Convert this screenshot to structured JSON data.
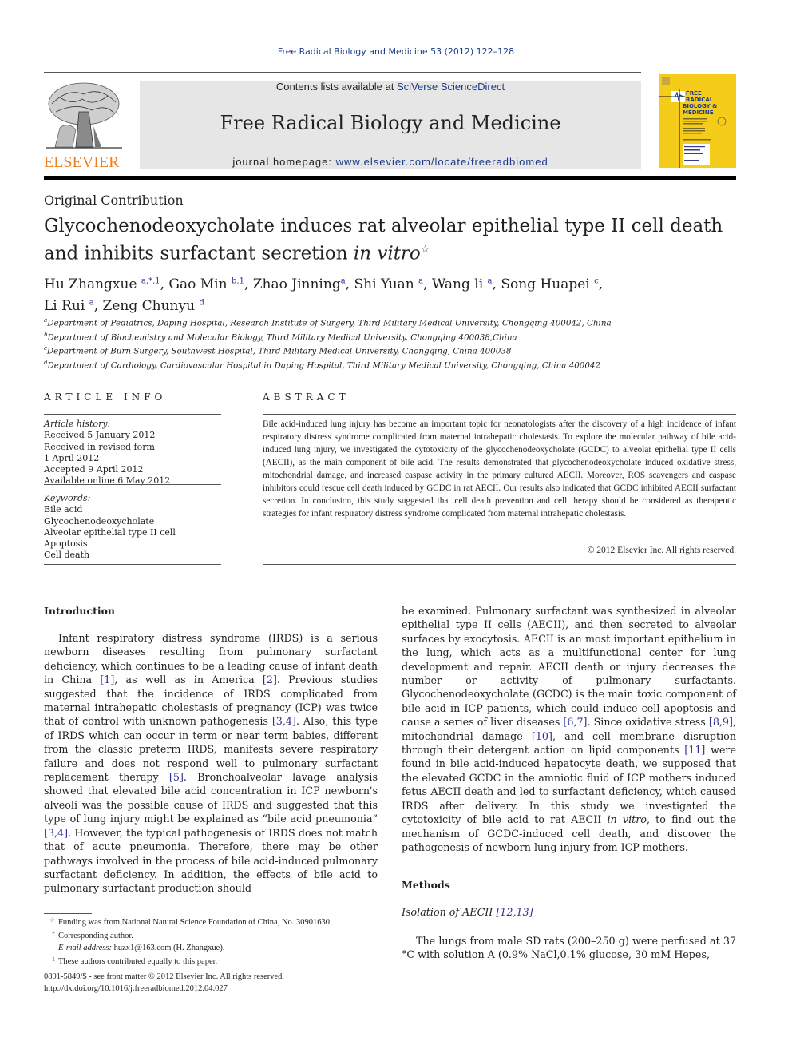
{
  "running_head": "Free Radical Biology and Medicine 53 (2012) 122–128",
  "masthead": {
    "publisher_logo_text": "ELSEVIER",
    "contents_prefix": "Contents lists available at ",
    "contents_link": "SciVerse ScienceDirect",
    "journal_title": "Free Radical Biology and Medicine",
    "homepage_prefix": "journal homepage: ",
    "homepage_link": "www.elsevier.com/locate/freeradbiomed",
    "cover_title_lines": [
      "FREE",
      "RADICAL",
      "BIOLOGY &",
      "MEDICINE"
    ],
    "colors": {
      "elsevier_orange": "#f07f1b",
      "cover_yellow": "#f6cc1a",
      "link_blue": "#1a3a8a",
      "box_gray": "#e6e6e7"
    }
  },
  "article": {
    "type": "Original Contribution",
    "title_line1": "Glycochenodeoxycholate induces rat alveolar epithelial type II cell death",
    "title_line2_prefix": "and inhibits surfactant secretion ",
    "title_line2_italic": "in vitro",
    "title_footnote_mark": "☆",
    "authors": [
      {
        "name": "Hu Zhangxue",
        "sup": "a,*,1",
        "sep": ", "
      },
      {
        "name": "Gao Min",
        "sup": "b,1",
        "sep": ", "
      },
      {
        "name": "Zhao Jinning",
        "sup": "a",
        "sep": ", "
      },
      {
        "name": "Shi Yuan",
        "sup": "a",
        "sep": ", "
      },
      {
        "name": "Wang li",
        "sup": "a",
        "sep": ", "
      },
      {
        "name": "Song Huapei",
        "sup": "c",
        "sep": ","
      },
      {
        "name": "Li Rui",
        "sup": "a",
        "sep": ", "
      },
      {
        "name": "Zeng Chunyu",
        "sup": "d",
        "sep": ""
      }
    ],
    "affiliations": [
      {
        "mark": "a",
        "text": "Department of Pediatrics, Daping Hospital, Research Institute of Surgery, Third Military Medical University, Chongqing 400042, China"
      },
      {
        "mark": "b",
        "text": "Department of Biochemistry and Molecular Biology, Third Military Medical University, Chongqing 400038,China"
      },
      {
        "mark": "c",
        "text": "Department of Burn Surgery, Southwest Hospital, Third Military Medical University, Chongqing, China 400038"
      },
      {
        "mark": "d",
        "text": "Department of Cardiology, Cardiovascular Hospital in Daping Hospital, Third Military Medical University, Chongqing, China 400042"
      }
    ]
  },
  "article_info": {
    "heading": "ARTICLE INFO",
    "history_label": "Article history:",
    "history": [
      "Received 5 January 2012",
      "Received in revised form",
      "1 April 2012",
      "Accepted 9 April 2012",
      "Available online 6 May 2012"
    ],
    "keywords_label": "Keywords:",
    "keywords": [
      "Bile acid",
      "Glycochenodeoxycholate",
      "Alveolar epithelial type II cell",
      "Apoptosis",
      "Cell death"
    ]
  },
  "abstract": {
    "heading": "ABSTRACT",
    "text": "Bile acid-induced lung injury has become an important topic for neonatologists after the discovery of a high incidence of infant respiratory distress syndrome complicated from maternal intrahepatic cholestasis. To explore the molecular pathway of bile acid-induced lung injury, we investigated the cytotoxicity of the glycochenodeoxycholate (GCDC) to alveolar epithelial type II cells (AECII), as the main component of bile acid. The results demonstrated that glycochenodeoxycholate induced oxidative stress, mitochondrial damage, and increased caspase activity in the primary cultured AECII. Moreover, ROS scavengers and caspase inhibitors could rescue cell death induced by GCDC in rat AECII. Our results also indicated that GCDC inhibited AECII surfactant secretion. In conclusion, this study suggested that cell death prevention and cell therapy should be considered as therapeutic strategies for infant respiratory distress syndrome complicated from maternal intrahepatic cholestasis.",
    "copyright": "© 2012 Elsevier Inc. All rights reserved."
  },
  "body": {
    "intro_heading": "Introduction",
    "left_column": [
      {
        "t": "Infant respiratory distress syndrome (IRDS) is a serious newborn diseases resulting from pulmonary surfactant deficiency, which continues to be a leading cause of infant death in China "
      },
      {
        "c": "[1]"
      },
      {
        "t": ", as well as in America "
      },
      {
        "c": "[2]"
      },
      {
        "t": ". Previous studies suggested that the incidence of IRDS complicated from maternal intrahepatic cholestasis of pregnancy (ICP) was twice that of control with unknown pathogenesis "
      },
      {
        "c": "[3,4]"
      },
      {
        "t": ". Also, this type of IRDS which can occur in term or near term babies, different from the classic preterm IRDS, manifests severe respiratory failure and does not respond well to pulmonary surfactant replacement therapy "
      },
      {
        "c": "[5]"
      },
      {
        "t": ". Bronchoalveolar lavage analysis showed that elevated bile acid concentration in ICP newborn's alveoli was the possible cause of IRDS and suggested that this type of lung injury might be explained as “bile acid pneumonia” "
      },
      {
        "c": "[3,4]"
      },
      {
        "t": ". However, the typical pathogenesis of IRDS does not match that of acute pneumonia. Therefore, there may be other pathways involved in the process of bile acid-induced pulmonary surfactant deficiency. In addition, the effects of bile acid to pulmonary surfactant production should"
      }
    ],
    "right_column": [
      {
        "t": "be examined. Pulmonary surfactant was synthesized in alveolar epithelial type II cells (AECII), and then secreted to alveolar surfaces by exocytosis. AECII is an most important epithelium in the lung, which acts as a multifunctional center for lung development and repair. AECII death or injury decreases the number or activity of pulmonary surfactants. Glycochenodeoxycholate (GCDC) is the main toxic component of bile acid in ICP patients, which could induce cell apoptosis and cause a series of liver diseases "
      },
      {
        "c": "[6,7]"
      },
      {
        "t": ". Since oxidative stress "
      },
      {
        "c": "[8,9]"
      },
      {
        "t": ", mitochondrial damage "
      },
      {
        "c": "[10]"
      },
      {
        "t": ", and cell membrane disruption through their detergent action on lipid components "
      },
      {
        "c": "[11]"
      },
      {
        "t": " were found in bile acid-induced hepatocyte death, we supposed that the elevated GCDC in the amniotic fluid of ICP mothers induced fetus AECII death and led to surfactant deficiency, which caused IRDS after delivery. In this study we investigated the cytotoxicity of bile acid to rat AECII "
      },
      {
        "i": "in vitro"
      },
      {
        "t": ", to find out the mechanism of GCDC-induced cell death, and discover the pathogenesis of newborn lung injury from ICP mothers."
      }
    ],
    "methods_heading": "Methods",
    "isolation_heading": "Isolation of AECII ",
    "isolation_cite": "[12,13]",
    "methods_text": "The lungs from male SD rats (200–250 g) were perfused at 37 °C with solution A (0.9% NaCl,0.1% glucose, 30 mM Hepes,"
  },
  "footnotes": {
    "funding_mark": "☆",
    "funding": "Funding was from National Natural Science Foundation of China, No. 30901630.",
    "corresponding_mark": "*",
    "corresponding": "Corresponding author.",
    "email_label": "E-mail address:",
    "email": "huzx1@163.com (H. Zhangxue).",
    "equal_mark": "1",
    "equal": "These authors contributed equally to this paper.",
    "issn_line": "0891-5849/$ - see front matter © 2012 Elsevier Inc. All rights reserved.",
    "doi_line": "http://dx.doi.org/10.1016/j.freeradbiomed.2012.04.027"
  }
}
